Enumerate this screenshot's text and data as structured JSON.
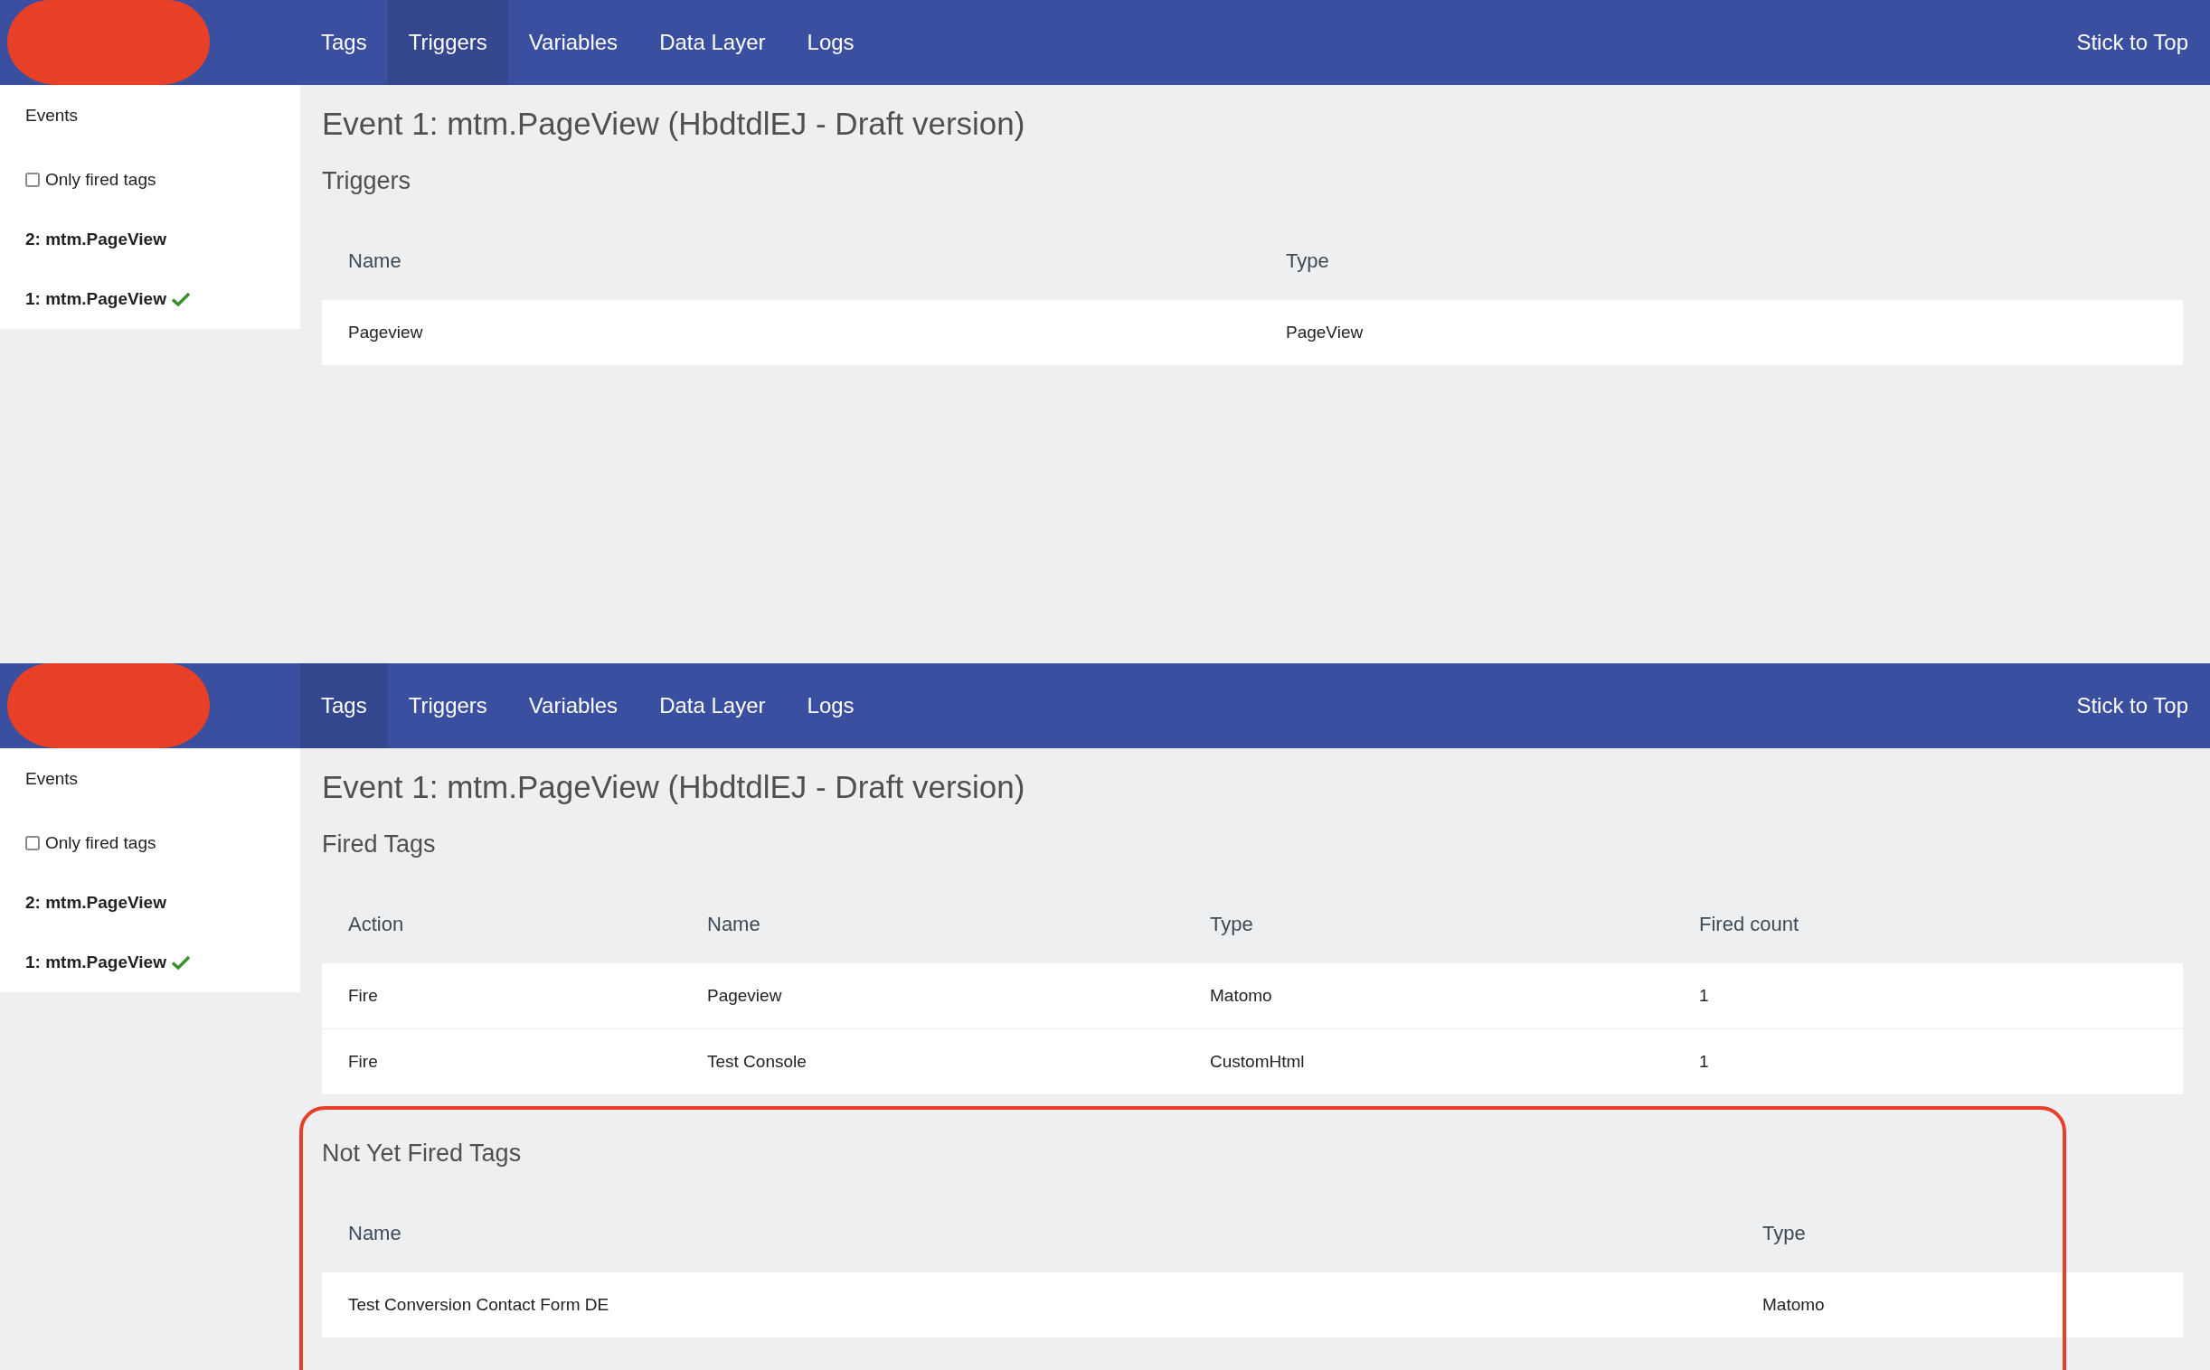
{
  "panels": [
    {
      "nav": {
        "tabs": [
          {
            "label": "Tags",
            "selected": false
          },
          {
            "label": "Triggers",
            "selected": true
          },
          {
            "label": "Variables",
            "selected": false
          },
          {
            "label": "Data Layer",
            "selected": false
          },
          {
            "label": "Logs",
            "selected": false
          }
        ],
        "stick_to_top": "Stick to Top"
      },
      "sidebar": {
        "heading": "Events",
        "only_fired": {
          "label": "Only fired tags",
          "checked": false
        },
        "events": [
          {
            "label": "2: mtm.PageView",
            "fired": false
          },
          {
            "label": "1: mtm.PageView",
            "fired": true
          }
        ]
      },
      "title": "Event 1: mtm.PageView (HbdtdlEJ - Draft version)",
      "sections": [
        {
          "kind": "triggers",
          "heading": "Triggers",
          "highlighted": false,
          "columns": [
            "Name",
            "Type"
          ],
          "rows": [
            [
              "Pageview",
              "PageView"
            ]
          ]
        }
      ]
    },
    {
      "nav": {
        "tabs": [
          {
            "label": "Tags",
            "selected": true
          },
          {
            "label": "Triggers",
            "selected": false
          },
          {
            "label": "Variables",
            "selected": false
          },
          {
            "label": "Data Layer",
            "selected": false
          },
          {
            "label": "Logs",
            "selected": false
          }
        ],
        "stick_to_top": "Stick to Top"
      },
      "sidebar": {
        "heading": "Events",
        "only_fired": {
          "label": "Only fired tags",
          "checked": false
        },
        "events": [
          {
            "label": "2: mtm.PageView",
            "fired": false
          },
          {
            "label": "1: mtm.PageView",
            "fired": true
          }
        ]
      },
      "title": "Event 1: mtm.PageView (HbdtdlEJ - Draft version)",
      "sections": [
        {
          "kind": "fired_tags",
          "heading": "Fired Tags",
          "highlighted": false,
          "columns": [
            "Action",
            "Name",
            "Type",
            "Fired count"
          ],
          "rows": [
            [
              "Fire",
              "Pageview",
              "Matomo",
              "1"
            ],
            [
              "Fire",
              "Test Console",
              "CustomHtml",
              "1"
            ]
          ]
        },
        {
          "kind": "not_fired_tags",
          "heading": "Not Yet Fired Tags",
          "highlighted": true,
          "columns": [
            "Name",
            "Type"
          ],
          "rows": [
            [
              "Test Conversion Contact Form DE",
              "Matomo"
            ]
          ]
        }
      ]
    }
  ]
}
